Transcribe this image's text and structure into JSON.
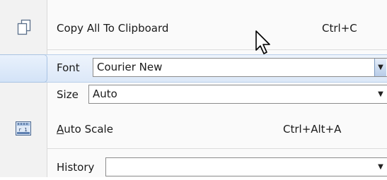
{
  "menu": {
    "copy_all": {
      "label": "Copy All To Clipboard",
      "shortcut": "Ctrl+C",
      "icon": "copy-icon"
    },
    "font": {
      "label": "Font",
      "value": "Courier New"
    },
    "size": {
      "label": "Size",
      "value": "Auto"
    },
    "auto_scale": {
      "label_underlined": "A",
      "label_rest": "uto Scale",
      "shortcut": "Ctrl+Alt+A",
      "icon": "ruler-icon"
    },
    "history": {
      "label": "History",
      "value": ""
    }
  },
  "colors": {
    "highlight": "#dce8f8",
    "highlight_border": "#b8cfea",
    "gutter": "#f2f2f2"
  }
}
